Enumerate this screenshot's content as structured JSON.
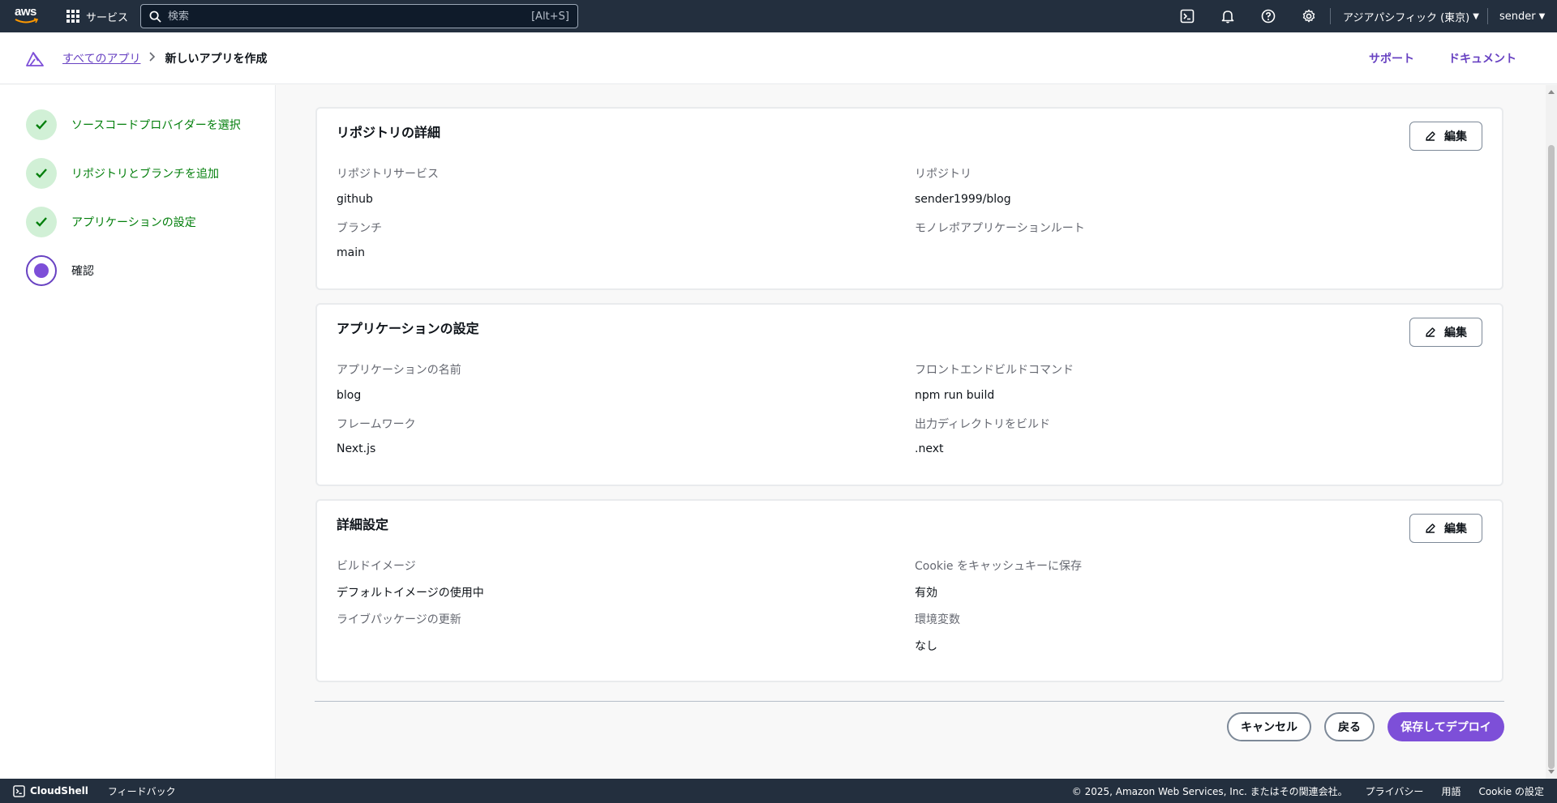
{
  "topnav": {
    "logo_text": "aws",
    "services_label": "サービス",
    "search_placeholder": "検索",
    "search_shortcut": "[Alt+S]",
    "region_label": "アジアパシフィック (東京)",
    "user_label": "sender"
  },
  "header": {
    "breadcrumb_root": "すべてのアプリ",
    "breadcrumb_current": "新しいアプリを作成",
    "support_link": "サポート",
    "docs_link": "ドキュメント"
  },
  "steps": [
    {
      "label": "ソースコードプロバイダーを選択",
      "status": "complete"
    },
    {
      "label": "リポジトリとブランチを追加",
      "status": "complete"
    },
    {
      "label": "アプリケーションの設定",
      "status": "complete"
    },
    {
      "label": "確認",
      "status": "current"
    }
  ],
  "cards": {
    "repo": {
      "title": "リポジトリの詳細",
      "edit_label": "編集",
      "repo_service_label": "リポジトリサービス",
      "repo_service_value": "github",
      "repository_label": "リポジトリ",
      "repository_value": "sender1999/blog",
      "branch_label": "ブランチ",
      "branch_value": "main",
      "monorepo_label": "モノレポアプリケーションルート"
    },
    "app": {
      "title": "アプリケーションの設定",
      "edit_label": "編集",
      "app_name_label": "アプリケーションの名前",
      "app_name_value": "blog",
      "build_cmd_label": "フロントエンドビルドコマンド",
      "build_cmd_value": "npm run build",
      "framework_label": "フレームワーク",
      "framework_value": "Next.js",
      "output_dir_label": "出力ディレクトリをビルド",
      "output_dir_value": ".next"
    },
    "advanced": {
      "title": "詳細設定",
      "edit_label": "編集",
      "build_image_label": "ビルドイメージ",
      "build_image_value": "デフォルトイメージの使用中",
      "cookie_label": "Cookie をキャッシュキーに保存",
      "cookie_value": "有効",
      "live_pkg_label": "ライブパッケージの更新",
      "env_vars_label": "環境変数",
      "env_vars_value": "なし"
    }
  },
  "actions": {
    "cancel": "キャンセル",
    "back": "戻る",
    "save_deploy": "保存してデプロイ"
  },
  "footer": {
    "cloudshell": "CloudShell",
    "feedback": "フィードバック",
    "copyright": "© 2025, Amazon Web Services, Inc. またはその関連会社。",
    "privacy": "プライバシー",
    "terms": "用語",
    "cookie_settings": "Cookie の設定"
  },
  "colors": {
    "nav_bg": "#232f3e",
    "accent_purple": "#7d4fd8",
    "link_purple": "#6842c2",
    "success_green": "#037f0c"
  }
}
